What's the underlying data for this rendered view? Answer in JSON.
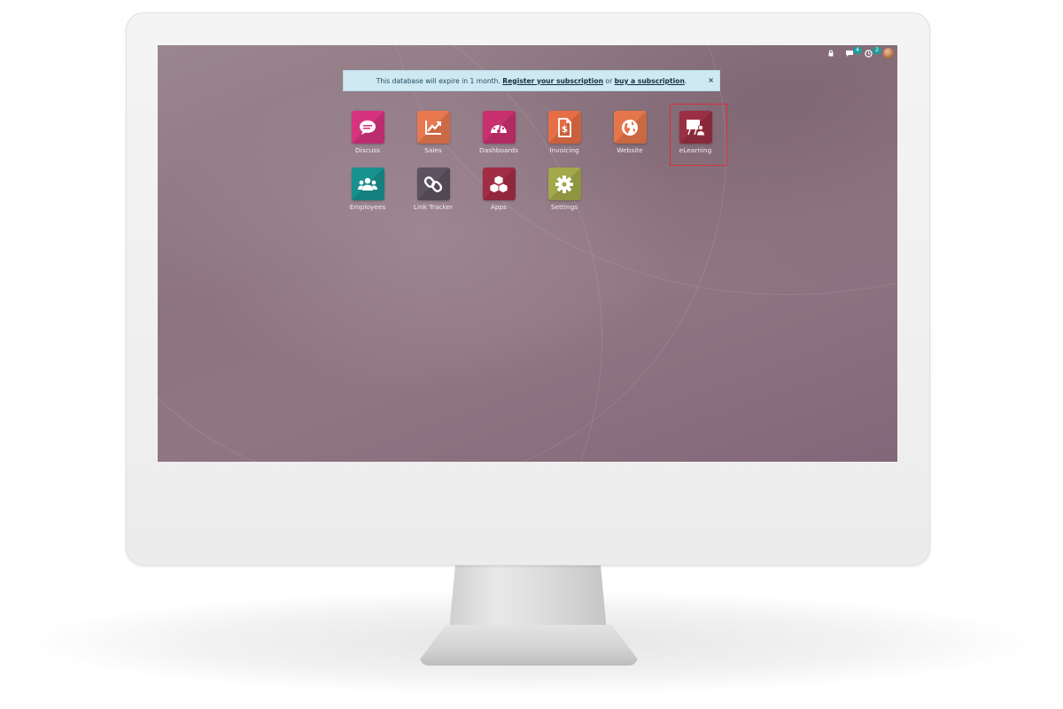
{
  "banner": {
    "text_before": "This database will expire in 1 month.",
    "link_register": "Register your subscription",
    "text_or": "or",
    "link_buy": "buy a subscription",
    "text_end": ".",
    "close": "×"
  },
  "topbar": {
    "messages_count": "4",
    "activities_count": "2"
  },
  "apps": [
    {
      "label": "Discuss",
      "icon": "chat-bubble-icon",
      "color": "#d6337f"
    },
    {
      "label": "Sales",
      "icon": "trend-chart-icon",
      "color": "#e8784f"
    },
    {
      "label": "Dashboards",
      "icon": "gauge-icon",
      "color": "#c9306f"
    },
    {
      "label": "Invoicing",
      "icon": "invoice-dollar-icon",
      "color": "#e56e46"
    },
    {
      "label": "Website",
      "icon": "globe-icon",
      "color": "#e5764a"
    },
    {
      "label": "eLearning",
      "icon": "presentation-user-icon",
      "color": "#9b2f43"
    },
    {
      "label": "Employees",
      "icon": "people-group-icon",
      "color": "#17918e"
    },
    {
      "label": "Link Tracker",
      "icon": "chain-link-icon",
      "color": "#5d5260"
    },
    {
      "label": "Apps",
      "icon": "cubes-icon",
      "color": "#a32c45"
    },
    {
      "label": "Settings",
      "icon": "gear-icon",
      "color": "#a3a84a"
    }
  ],
  "highlighted_app": "eLearning",
  "highlight_color": "#d62f3c"
}
